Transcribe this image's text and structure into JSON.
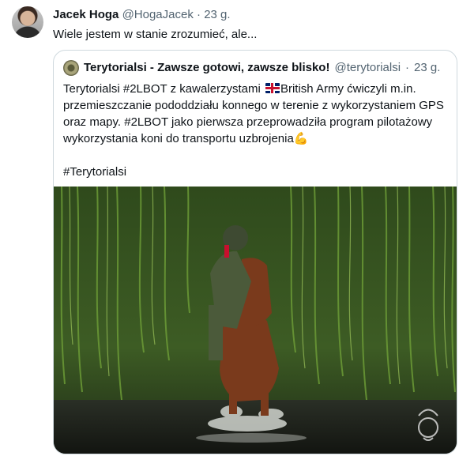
{
  "tweet": {
    "author_name": "Jacek Hoga",
    "author_handle": "@HogaJacek",
    "separator": "·",
    "time": "23 g.",
    "text": "Wiele jestem w stanie zrozumieć, ale..."
  },
  "quote": {
    "author_name": "Terytorialsi - Zawsze gotowi, zawsze blisko!",
    "author_handle": "@terytorialsi",
    "separator": "·",
    "time": "23 g.",
    "text_part1": "Terytorialsi  #2LBOT z kawalerzystami ",
    "text_part2": "British Army ćwiczyli m.in. przemieszczanie pododdziału konnego w terenie z wykorzystaniem GPS oraz mapy. #2LBOT jako pierwsza przeprowadziła program pilotażowy wykorzystania koni do transportu uzbrojenia",
    "flex_emoji": "💪",
    "hashtag_line": "#Terytorialsi"
  },
  "icons": {
    "flag": "uk-flag-icon",
    "emoji": "flexed-biceps-icon",
    "watermark": "eagle-emblem-icon"
  },
  "colors": {
    "text": "#0f1419",
    "secondary": "#536471",
    "border": "#cfd9de",
    "foliage": "#4e7a2a",
    "horse": "#7a3a1c"
  }
}
